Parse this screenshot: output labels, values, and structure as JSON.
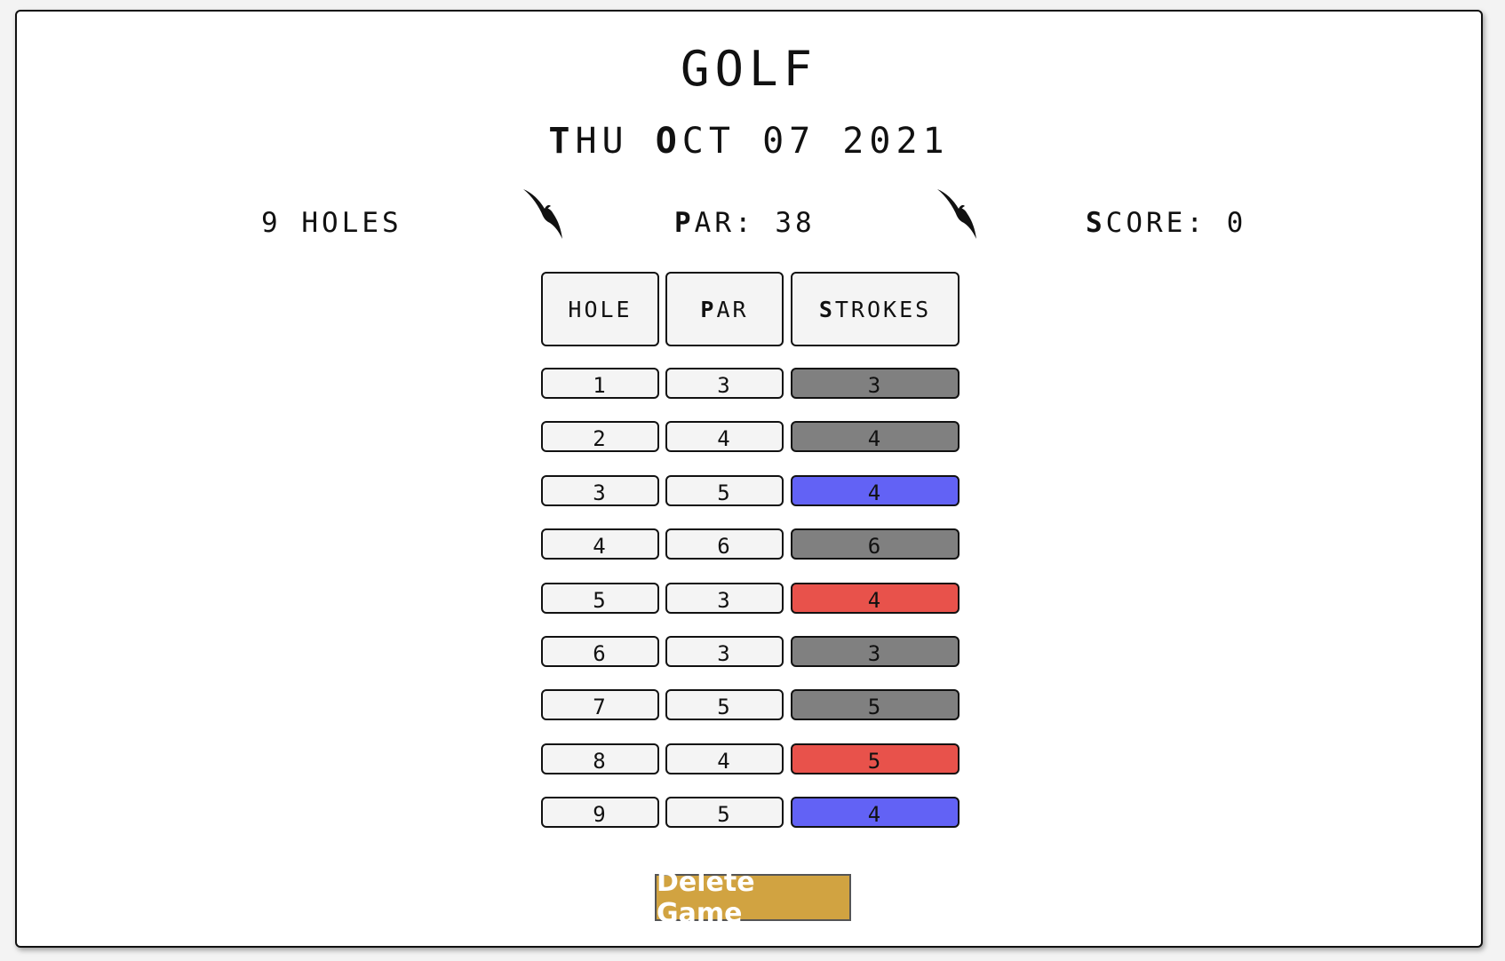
{
  "title": "GOLF",
  "date": {
    "first": [
      "T",
      "HU"
    ],
    "second": [
      "O",
      "CT"
    ],
    "rest": "07 2021"
  },
  "holes_label": "9 HOLES",
  "par_label": {
    "bold": "P",
    "rest": "AR: 38"
  },
  "score_label": {
    "bold": "S",
    "rest": "CORE: 0"
  },
  "headers": {
    "hole": "HOLE",
    "par": {
      "bold": "P",
      "rest": "AR"
    },
    "strokes": {
      "bold": "S",
      "rest": "TROKES"
    }
  },
  "rows": [
    {
      "hole": "1",
      "par": "3",
      "strokes": "3",
      "status": "par"
    },
    {
      "hole": "2",
      "par": "4",
      "strokes": "4",
      "status": "par"
    },
    {
      "hole": "3",
      "par": "5",
      "strokes": "4",
      "status": "under"
    },
    {
      "hole": "4",
      "par": "6",
      "strokes": "6",
      "status": "par"
    },
    {
      "hole": "5",
      "par": "3",
      "strokes": "4",
      "status": "over"
    },
    {
      "hole": "6",
      "par": "3",
      "strokes": "3",
      "status": "par"
    },
    {
      "hole": "7",
      "par": "5",
      "strokes": "5",
      "status": "par"
    },
    {
      "hole": "8",
      "par": "4",
      "strokes": "5",
      "status": "over"
    },
    {
      "hole": "9",
      "par": "5",
      "strokes": "4",
      "status": "under"
    }
  ],
  "colors": {
    "par": "#808080",
    "under": "#6262f5",
    "over": "#e8524b",
    "button": "#d1a341"
  },
  "icons": [
    "bird-icon",
    "bird-icon"
  ],
  "delete_button": "Delete Game"
}
